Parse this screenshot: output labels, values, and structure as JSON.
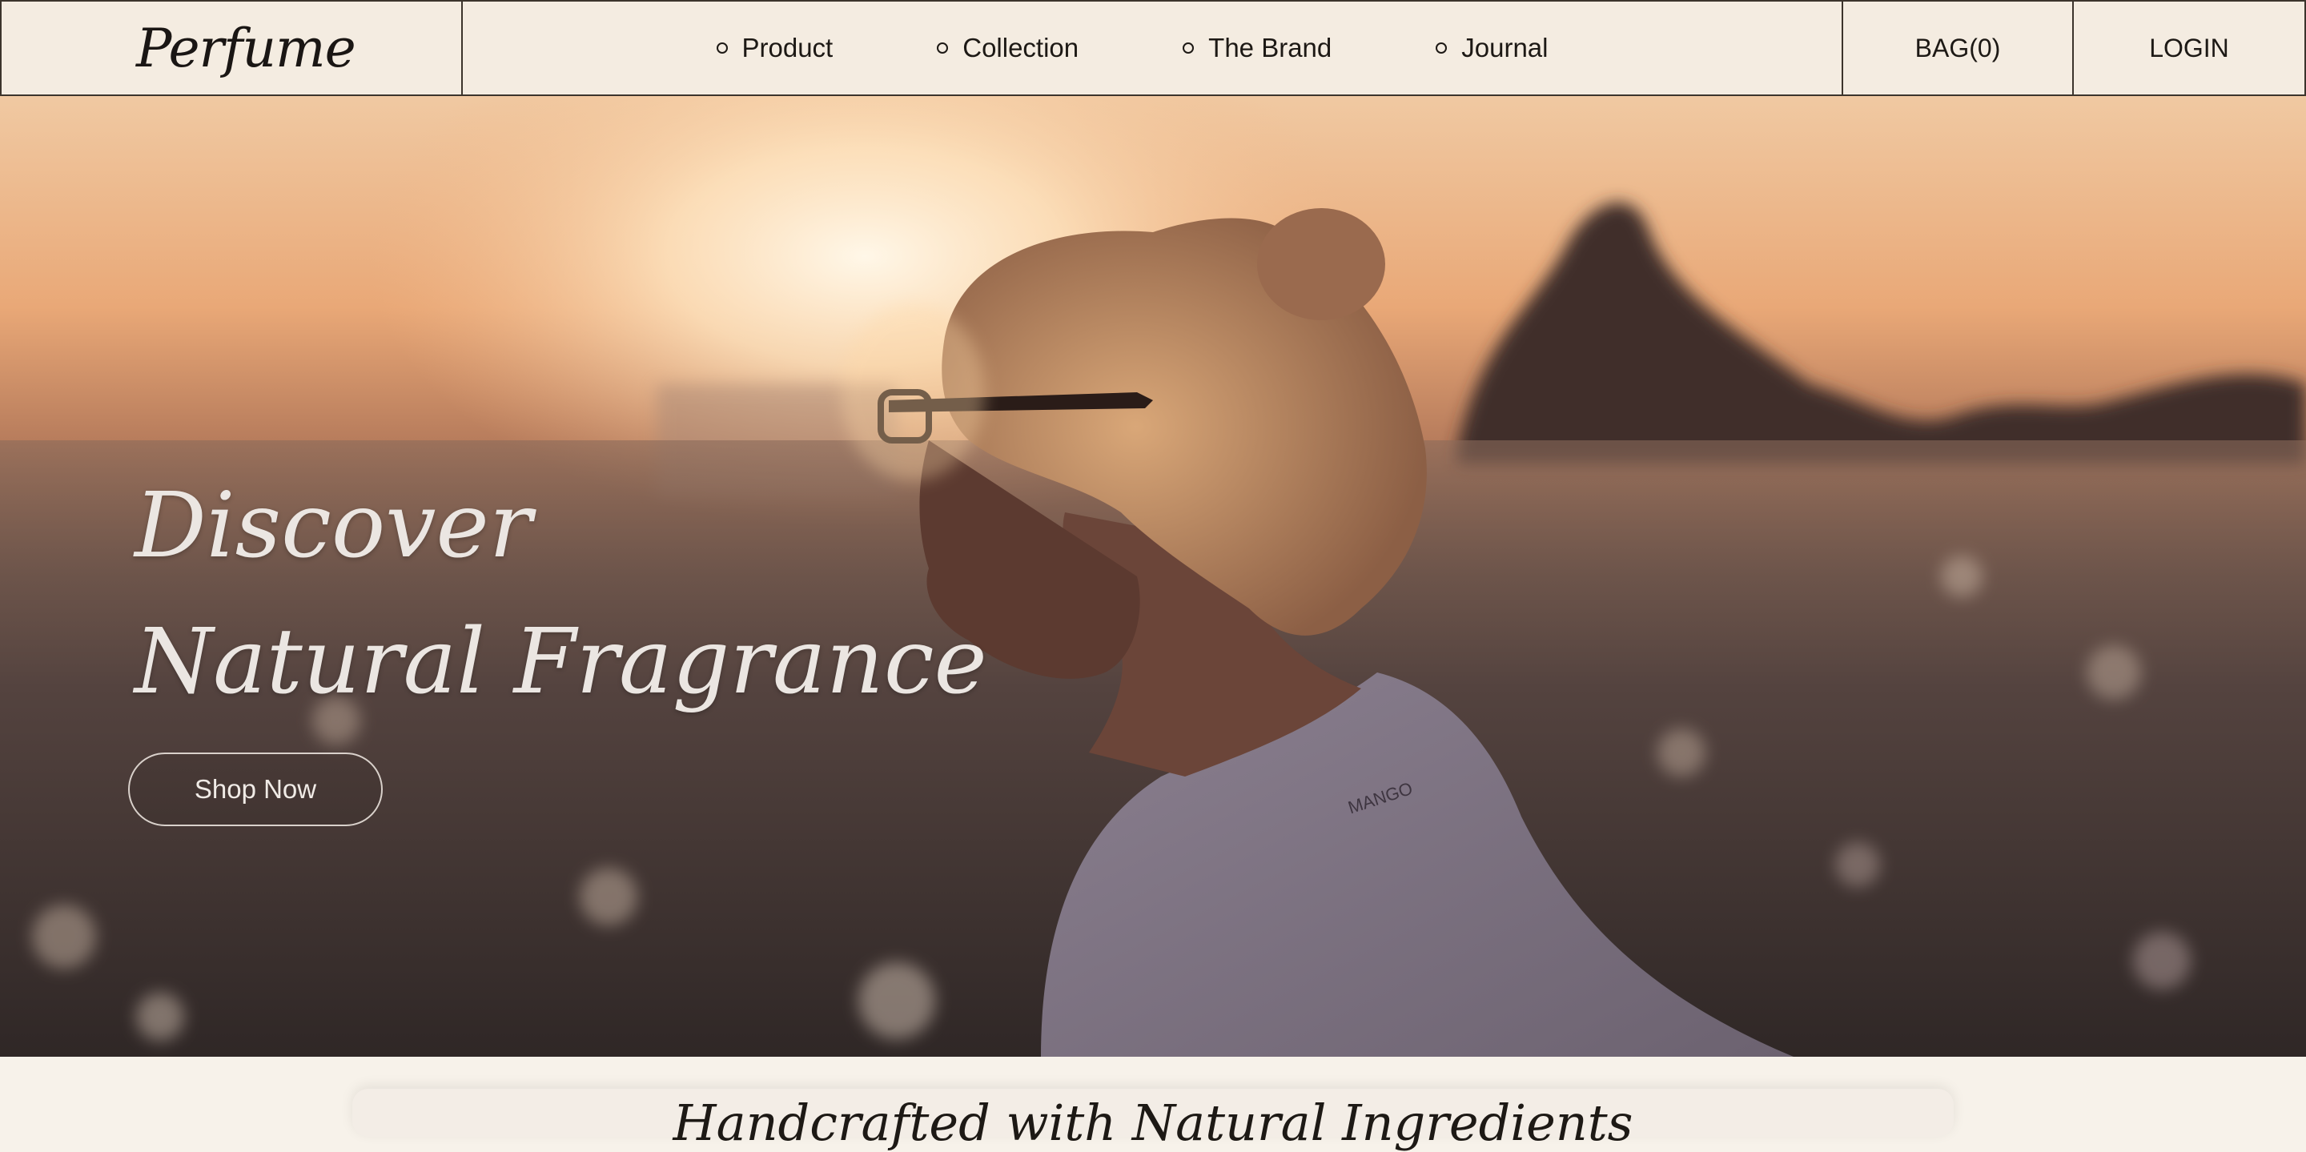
{
  "brand": {
    "logo_text": "Perfume"
  },
  "nav": {
    "items": [
      {
        "label": "Product"
      },
      {
        "label": "Collection"
      },
      {
        "label": "The Brand"
      },
      {
        "label": "Journal"
      }
    ],
    "bag_label": "BAG(0)",
    "login_label": "LOGIN"
  },
  "hero": {
    "title_line1": "Discover",
    "title_line2": "Natural Fragrance",
    "cta_label": "Shop Now",
    "shirt_text": "MANGO"
  },
  "next_section": {
    "heading_partial": "Handcrafted with Natural Ingredients"
  },
  "colors": {
    "nav_bg": "#f4ece1",
    "border": "#3c342c",
    "hero_title": "#ebe6e2",
    "page_bg": "#f7f2ea"
  }
}
